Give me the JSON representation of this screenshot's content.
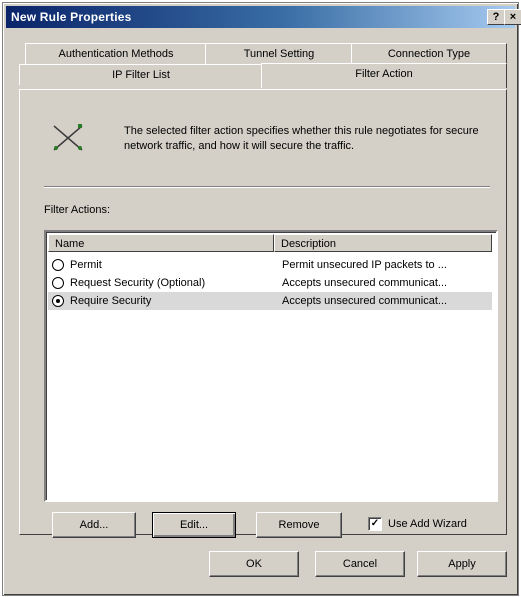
{
  "window": {
    "title": "New Rule Properties",
    "help_glyph": "?",
    "close_glyph": "×"
  },
  "tabs": {
    "row1": [
      "Authentication Methods",
      "Tunnel Setting",
      "Connection Type"
    ],
    "row2": [
      "IP Filter List",
      "Filter Action"
    ],
    "active": "Filter Action"
  },
  "panel": {
    "info_text": "The selected filter action specifies whether this rule negotiates for secure network traffic, and how it will secure the traffic.",
    "filter_actions_label": "Filter Actions:",
    "columns": {
      "name": "Name",
      "description": "Description"
    },
    "rows": [
      {
        "name": "Permit",
        "description": "Permit unsecured IP packets to ...",
        "selected": false
      },
      {
        "name": "Request Security (Optional)",
        "description": "Accepts unsecured communicat...",
        "selected": false
      },
      {
        "name": "Require Security",
        "description": "Accepts unsecured communicat...",
        "selected": true
      }
    ],
    "buttons": {
      "add": "Add...",
      "edit": "Edit...",
      "remove": "Remove"
    },
    "use_add_wizard": {
      "label": "Use Add Wizard",
      "checked": true,
      "mark": "✓"
    }
  },
  "footer": {
    "ok": "OK",
    "cancel": "Cancel",
    "apply": "Apply"
  },
  "icons": {
    "info": "crossed-cable-icon"
  }
}
